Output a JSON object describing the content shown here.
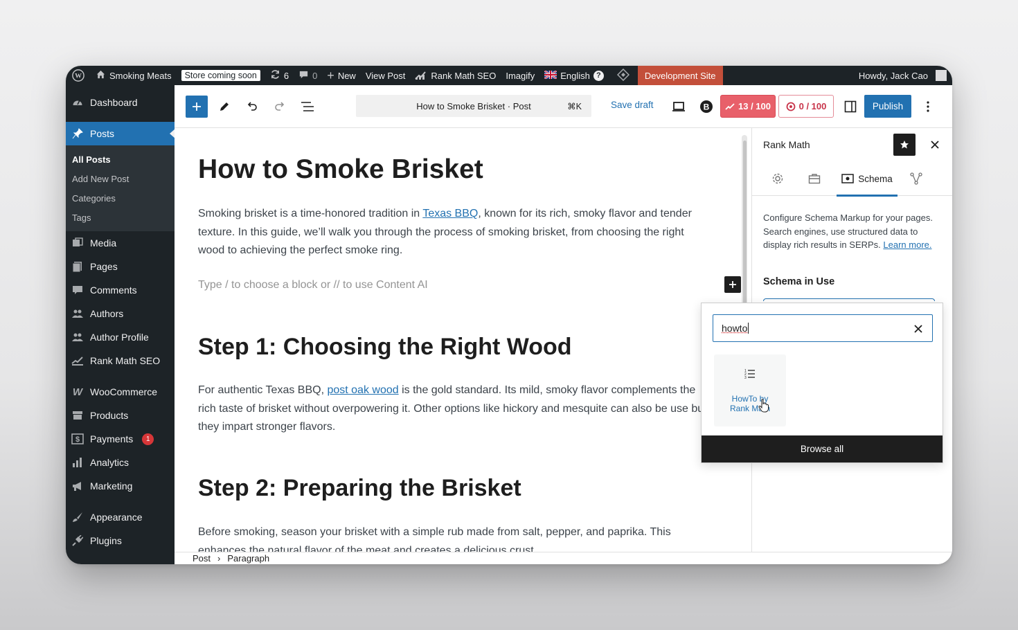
{
  "admin_bar": {
    "site_name": "Smoking Meats",
    "store_badge": "Store coming soon",
    "updates_count": "6",
    "comments_count": "0",
    "new_label": "New",
    "view_post": "View Post",
    "rank_math": "Rank Math SEO",
    "imagify": "Imagify",
    "language": "English",
    "dev_site": "Development Site",
    "greeting": "Howdy, Jack Cao"
  },
  "sidebar": {
    "dashboard": "Dashboard",
    "posts": "Posts",
    "submenu": [
      "All Posts",
      "Add New Post",
      "Categories",
      "Tags"
    ],
    "items": [
      "Media",
      "Pages",
      "Comments",
      "Authors",
      "Author Profile",
      "Rank Math SEO"
    ],
    "items2": [
      "WooCommerce",
      "Products",
      "Payments",
      "Analytics",
      "Marketing"
    ],
    "payments_badge": "1",
    "items3": [
      "Appearance",
      "Plugins"
    ]
  },
  "toolbar": {
    "doc_title": "How to Smoke Brisket · Post",
    "shortcut": "⌘K",
    "save_draft": "Save draft",
    "seo_score": "13 / 100",
    "ai_score": "0 / 100",
    "publish": "Publish"
  },
  "post": {
    "title": "How to Smoke Brisket",
    "intro_pre": "Smoking brisket is a time-honored tradition in ",
    "intro_link": "Texas BBQ",
    "intro_post": ", known for its rich, smoky flavor and tender texture. In this guide, we’ll walk you through the process of smoking brisket, from choosing the right wood to achieving the perfect smoke ring.",
    "placeholder": "Type / to choose a block or // to use Content AI",
    "step1_title": "Step 1: Choosing the Right Wood",
    "step1_pre": "For authentic Texas BBQ, ",
    "step1_link": "post oak wood",
    "step1_post": " is the gold standard. Its mild, smoky flavor complements the rich taste of brisket without overpowering it. Other options like hickory and mesquite can also be use but they impart stronger flavors.",
    "step2_title": "Step 2: Preparing the Brisket",
    "step2_text": "Before smoking, season your brisket with a simple rub made from salt, pepper, and paprika. This enhances the natural flavor of the meat and creates a delicious crust."
  },
  "breadcrumb": {
    "post": "Post",
    "separator": "›",
    "paragraph": "Paragraph"
  },
  "rank_math_panel": {
    "title": "Rank Math",
    "schema_tab": "Schema",
    "description": "Configure Schema Markup for your pages. Search engines, use structured data to display rich results in SERPs.",
    "learn_more": "Learn more.",
    "schema_in_use": "Schema in Use"
  },
  "schema_popover": {
    "search_value": "howto",
    "result_label": "HowTo by Rank Math",
    "browse_all": "Browse all"
  },
  "colors": {
    "wp_blue": "#2271b1",
    "admin_dark": "#1d2327",
    "seo_red": "#e8606a",
    "dev_site": "#c34f3a"
  }
}
